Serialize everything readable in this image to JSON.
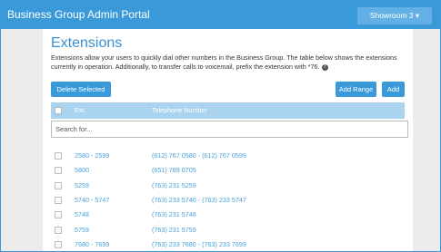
{
  "header": {
    "title": "Business Group Admin Portal",
    "showroom_label": "Showroom 3 ▾"
  },
  "page": {
    "title": "Extensions",
    "description": "Extensions allow your users to quickly dial other numbers in the Business Group. The table below shows the extensions currently in operation. Additionally, to transfer calls to voicemail, prefix the extension with *76.",
    "help_glyph": "?"
  },
  "toolbar": {
    "delete_label": "Delete Selected",
    "add_range_label": "Add Range",
    "add_label": "Add"
  },
  "table": {
    "columns": [
      "Ext.",
      "Telephone Number"
    ],
    "search_placeholder": "Search for...",
    "rows": [
      {
        "ext": "2580 - 2599",
        "phone": "(612) 767 0580 - (612) 767 0599"
      },
      {
        "ext": "5800",
        "phone": "(651) 789 0705"
      },
      {
        "ext": "5259",
        "phone": "(763) 231 5259"
      },
      {
        "ext": "5740 - 5747",
        "phone": "(763) 233 5740 - (763) 233 5747"
      },
      {
        "ext": "5748",
        "phone": "(763) 231 5748"
      },
      {
        "ext": "5759",
        "phone": "(763) 231 5759"
      },
      {
        "ext": "7680 - 7699",
        "phone": "(763) 233 7680 - (763) 233 7699"
      }
    ]
  },
  "colors": {
    "accent": "#3a9ad9",
    "header_row": "#a9d3ef",
    "link": "#4a9fd9",
    "page_bg": "#ececec"
  }
}
